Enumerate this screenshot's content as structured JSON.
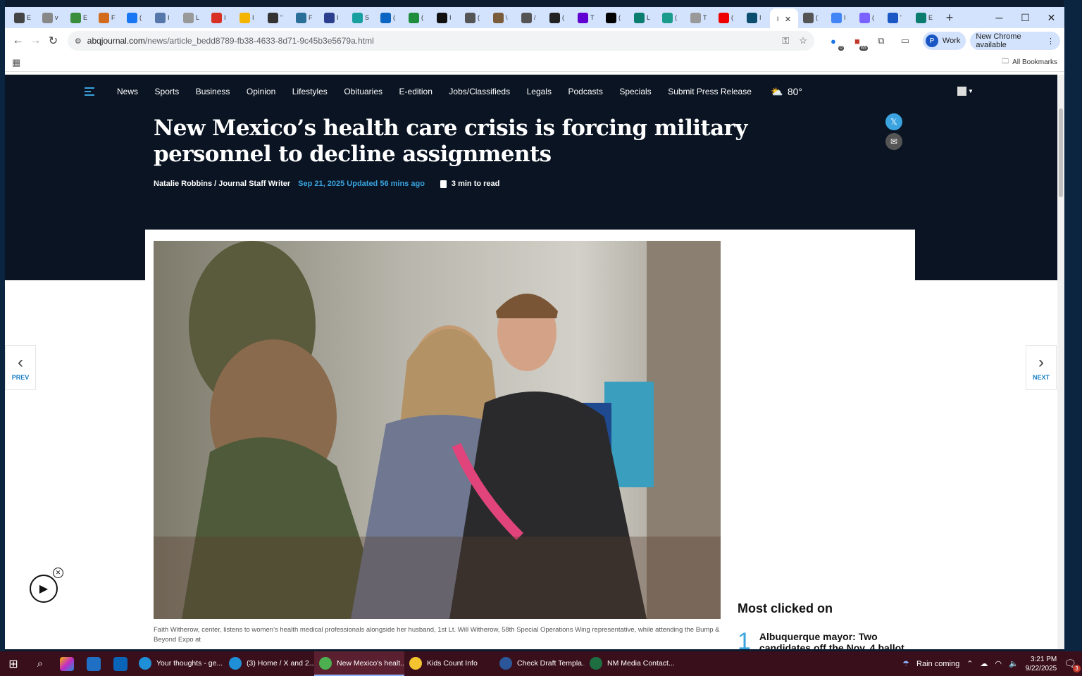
{
  "browser": {
    "tabs": [
      {
        "letter": "E",
        "color": "#444"
      },
      {
        "letter": "v",
        "color": "#888"
      },
      {
        "letter": "E",
        "color": "#3a8d3a"
      },
      {
        "letter": "F",
        "color": "#d36b1e"
      },
      {
        "letter": "(",
        "color": "#1877f2"
      },
      {
        "letter": "I",
        "color": "#5577aa"
      },
      {
        "letter": "L",
        "color": "#999"
      },
      {
        "letter": "I",
        "color": "#d93025"
      },
      {
        "letter": "I",
        "color": "#f5b400"
      },
      {
        "letter": "\"",
        "color": "#333"
      },
      {
        "letter": "F",
        "color": "#2a6f97"
      },
      {
        "letter": "I",
        "color": "#2b3f8e"
      },
      {
        "letter": "S",
        "color": "#18a0a0"
      },
      {
        "letter": "(",
        "color": "#0a66c2"
      },
      {
        "letter": "(",
        "color": "#1e8e3e"
      },
      {
        "letter": "I",
        "color": "#111"
      },
      {
        "letter": "(",
        "color": "#555"
      },
      {
        "letter": "\\",
        "color": "#7a5c3a"
      },
      {
        "letter": "/",
        "color": "#555"
      },
      {
        "letter": "(",
        "color": "#222"
      },
      {
        "letter": "T",
        "color": "#6001d2"
      },
      {
        "letter": "(",
        "color": "#000"
      },
      {
        "letter": "L",
        "color": "#0a7d6e"
      },
      {
        "letter": "(",
        "color": "#1a9c8c"
      },
      {
        "letter": "T",
        "color": "#999"
      },
      {
        "letter": "(",
        "color": "#e00"
      },
      {
        "letter": "I",
        "color": "#0a4d6e"
      }
    ],
    "active_tab_letter": "I",
    "tabs_after": [
      {
        "letter": "(",
        "color": "#555"
      },
      {
        "letter": "I",
        "color": "#4285f4"
      },
      {
        "letter": "(",
        "color": "#7b61ff"
      },
      {
        "letter": "'",
        "color": "#1a56c4"
      },
      {
        "letter": "E",
        "color": "#0a7d6e"
      }
    ],
    "url_host": "abqjournal.com",
    "url_path": "/news/article_bedd8789-fb38-4633-8d71-9c45b3e5679a.html",
    "ext_badge_1": "0",
    "ext_badge_2": "65",
    "profile_initial": "P",
    "profile_label": "Work",
    "update_label": "New Chrome available",
    "all_bookmarks": "All Bookmarks"
  },
  "site": {
    "nav": [
      "News",
      "Sports",
      "Business",
      "Opinion",
      "Lifestyles",
      "Obituaries",
      "E-edition",
      "Jobs/Classifieds",
      "Legals",
      "Podcasts",
      "Specials",
      "Submit Press Release"
    ],
    "weather_temp": "80°"
  },
  "article": {
    "headline": "New Mexico’s health care crisis is forcing military personnel to decline assignments",
    "author": "Natalie Robbins / Journal Staff Writer",
    "date": "Sep 21, 2025 Updated 56 mins ago",
    "read_time": "3 min to read",
    "caption": "Faith Witherow, center, listens to women’s health medical professionals alongside her husband, 1st Lt. Will Witherow, 58th Special Operations Wing representative, while attending the Bump & Beyond Expo at"
  },
  "sidebar": {
    "title": "Most clicked on",
    "items": [
      {
        "num": "1",
        "text": "Albuquerque mayor: Two candidates off the Nov. 4 ballot"
      }
    ]
  },
  "pager": {
    "prev": "PREV",
    "next": "NEXT"
  },
  "taskbar": {
    "apps": [
      {
        "label": "Your thoughts - ge...",
        "color": "#1f8fd8",
        "active": false
      },
      {
        "label": "(3) Home / X and 2...",
        "color": "#1f8fd8",
        "active": false
      },
      {
        "label": "New Mexico's healt...",
        "color": "#4caf50",
        "active": true
      },
      {
        "label": "Kids Count Info",
        "color": "#f4c430",
        "active": false
      },
      {
        "label": "Check Draft Templa...",
        "color": "#2b579a",
        "active": false
      },
      {
        "label": "NM Media Contact...",
        "color": "#1d6f42",
        "active": false
      }
    ],
    "weather": "Rain coming",
    "time": "3:21 PM",
    "date": "9/22/2025",
    "notifications": "3"
  }
}
